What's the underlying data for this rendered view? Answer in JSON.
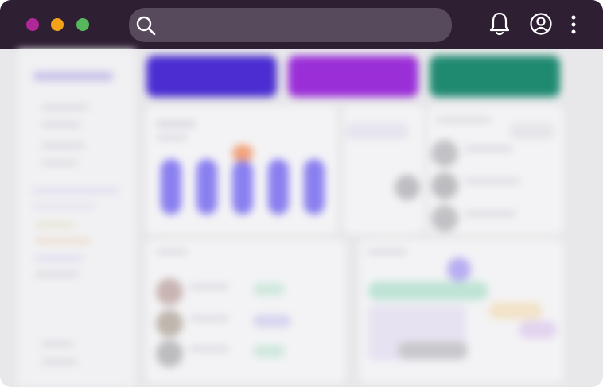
{
  "window": {
    "controls": [
      "close",
      "minimize",
      "maximize"
    ]
  },
  "toolbar": {
    "search_placeholder": "",
    "icons": [
      "search-icon",
      "bell-icon",
      "user-circle-icon",
      "more-vertical-icon"
    ]
  },
  "colors": {
    "topbar": "#2e1f33",
    "search_field": "#574a5c",
    "close": "#b0279a",
    "minimize": "#f4a21a",
    "maximize": "#56b85c",
    "stat_card_1": "#4b2dd1",
    "stat_card_2": "#9a2fd8",
    "stat_card_3": "#1f8a70",
    "chart_bars": "#8a7ff0",
    "chart_highlight": "#f2a27a"
  },
  "dashboard": {
    "note": ""
  }
}
